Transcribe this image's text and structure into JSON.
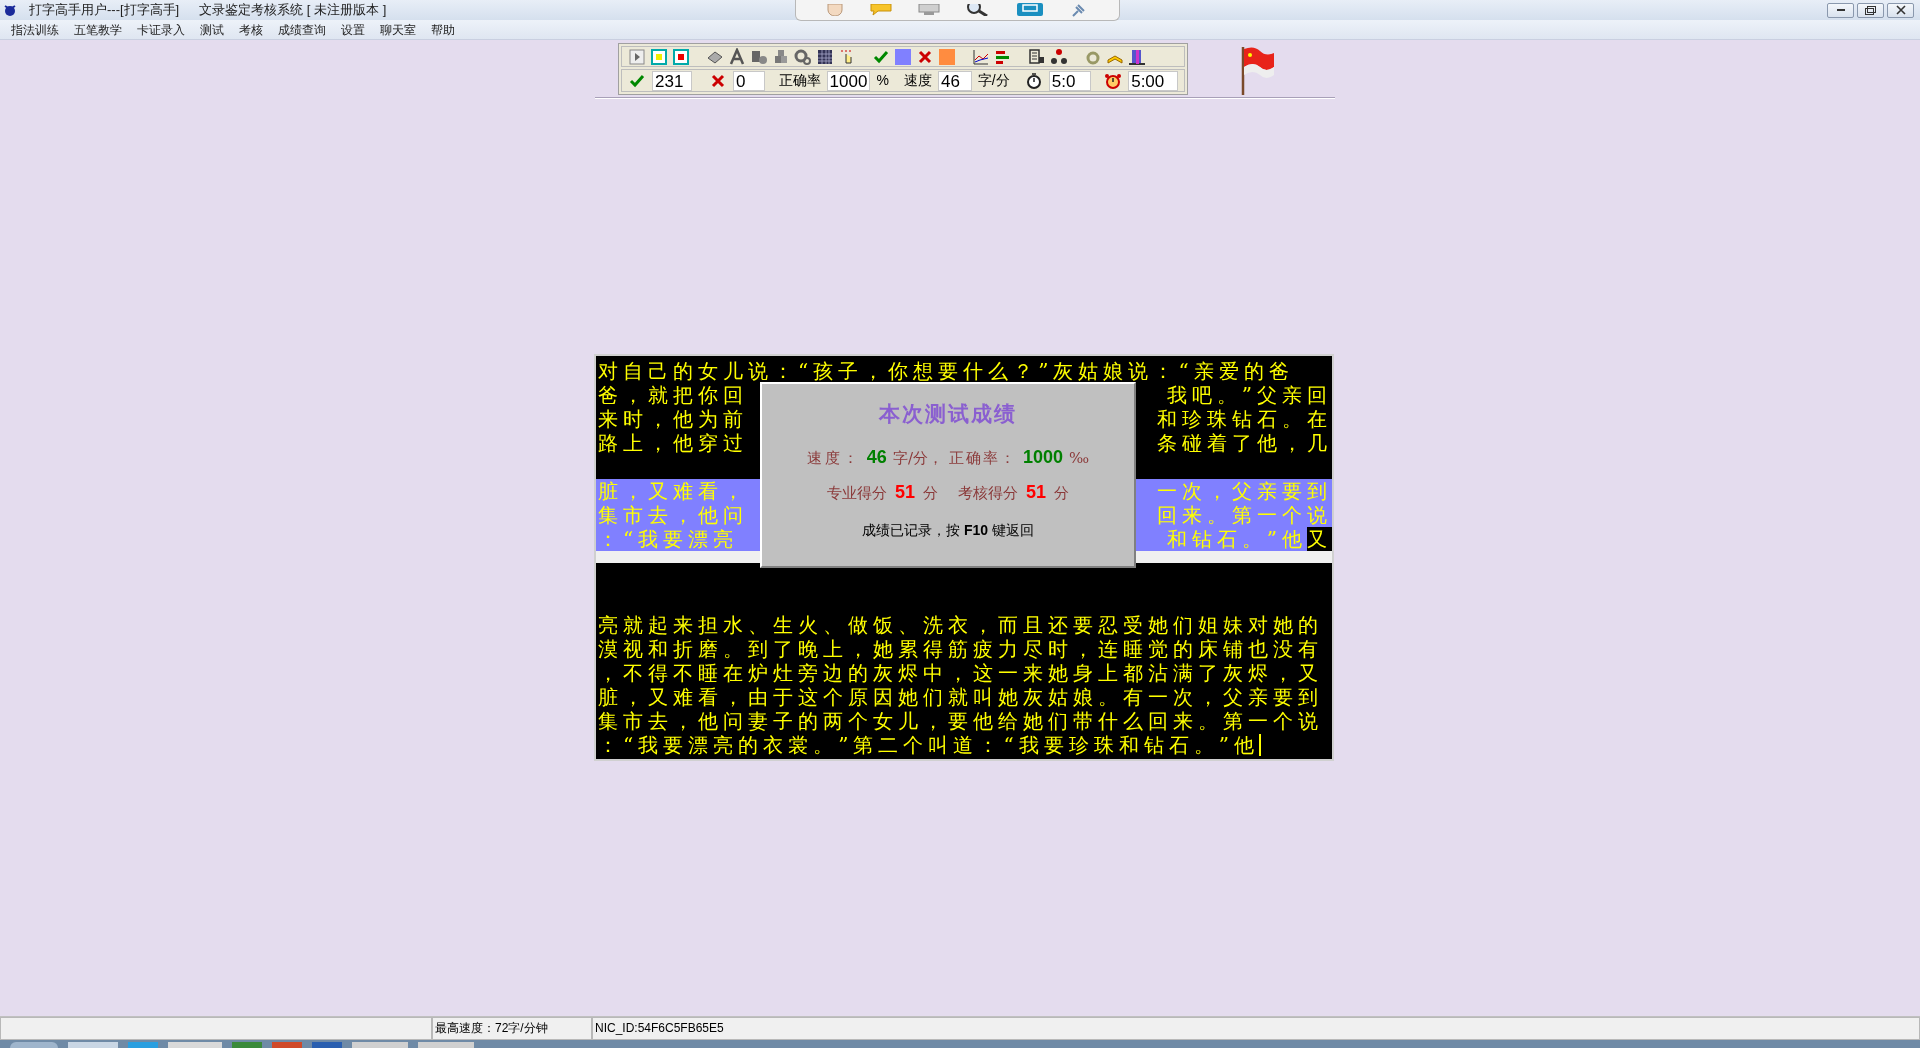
{
  "window": {
    "title": "打字高手用户---[打字高手]",
    "subtitle": "文录鉴定考核系统 [ 未注册版本 ]"
  },
  "menu": [
    "指法训练",
    "五笔教学",
    "卡证录入",
    "测试",
    "考核",
    "成绩查询",
    "设置",
    "聊天室",
    "帮助"
  ],
  "stats": {
    "correct": "231",
    "wrong": "0",
    "accuracy_label": "正确率",
    "accuracy": "1000",
    "accuracy_unit": "%",
    "speed_label": "速度",
    "speed": "46",
    "speed_unit": "字/分",
    "elapsed": "5:0",
    "limit": "5:00"
  },
  "source_lines": [
    {
      "kind": "plain",
      "left": "对自己的女儿说：“孩子，你想要什么？”灰姑娘说：“亲爱的爸"
    },
    {
      "kind": "plain",
      "left": "爸，就把你回",
      "right": "我吧。”父亲回"
    },
    {
      "kind": "plain",
      "left": "来时，他为前",
      "right": "和珍珠钻石。在"
    },
    {
      "kind": "plain",
      "left": "路上，他穿过",
      "right": "条碰着了他，几"
    },
    {
      "kind": "gap"
    },
    {
      "kind": "done",
      "left": "脏，又难看，",
      "right": "一次，父亲要到"
    },
    {
      "kind": "done",
      "left": "集市去，他问",
      "right": "回来。第一个说"
    },
    {
      "kind": "done",
      "left": "：“我要漂亮",
      "right": "和钻石。”他",
      "current": "又"
    }
  ],
  "typed_lines": [
    "亮就起来担水、生火、做饭、洗衣，而且还要忍受她们姐妹对她的",
    "漠视和折磨。到了晚上，她累得筋疲力尽时，连睡觉的床铺也没有",
    "，不得不睡在炉灶旁边的灰烬中，这一来她身上都沾满了灰烬，又",
    "脏，又难看，由于这个原因她们就叫她灰姑娘。有一次，父亲要到",
    "集市去，他问妻子的两个女儿，要他给她们带什么回来。第一个说",
    "：“我要漂亮的衣裳。”第二个叫道：“我要珍珠和钻石。”他"
  ],
  "result_dialog": {
    "title": "本次测试成绩",
    "speed_label": "速度：",
    "speed": "46",
    "speed_unit": "字/分，",
    "accuracy_label": "正确率：",
    "accuracy": "1000",
    "accuracy_unit": "‰",
    "pro_label": "专业得分",
    "pro_score": "51",
    "pro_unit": "分",
    "exam_label": "考核得分",
    "exam_score": "51",
    "exam_unit": "分",
    "footer": "成绩已记录，按 **F10** 键返回"
  },
  "status_bar": [
    "最高速度：72字/分钟",
    "NIC_ID:54F6C5FB65E5"
  ]
}
